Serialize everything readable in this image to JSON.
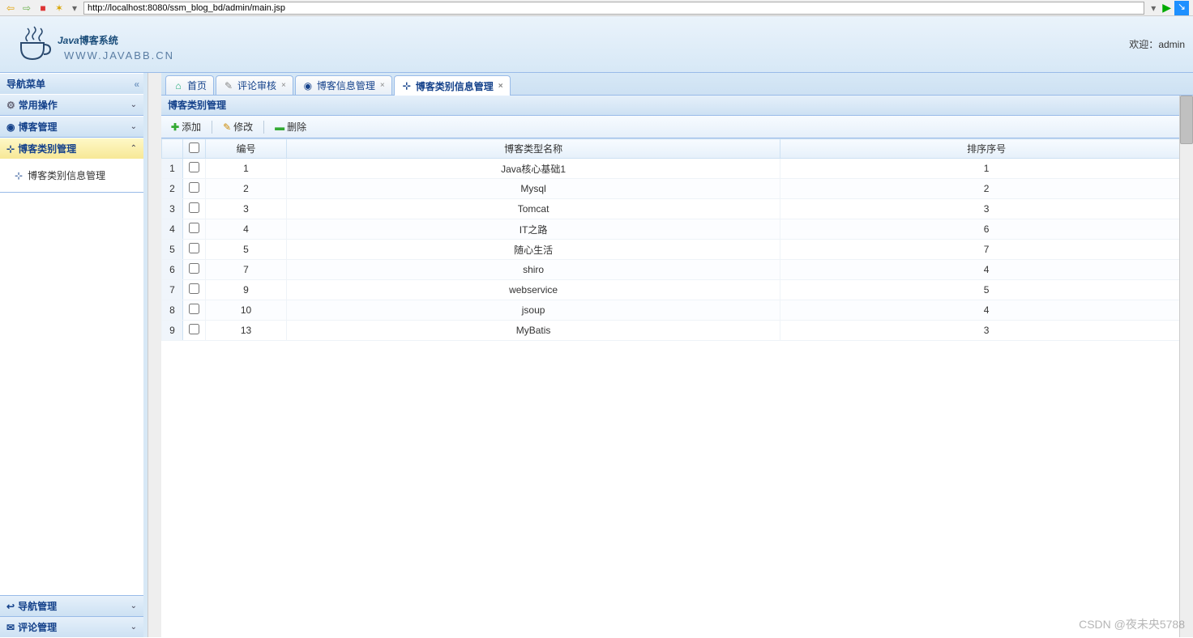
{
  "browser": {
    "url": "http://localhost:8080/ssm_blog_bd/admin/main.jsp"
  },
  "header": {
    "logo_main_en": "Java",
    "logo_main_cn": "博客系统",
    "logo_sub": "WWW.JAVABB.CN",
    "welcome_label": "欢迎：",
    "welcome_user": "admin"
  },
  "sidebar": {
    "title": "导航菜单",
    "sections": [
      {
        "icon": "gears",
        "label": "常用操作"
      },
      {
        "icon": "blog",
        "label": "博客管理"
      },
      {
        "icon": "tree",
        "label": "博客类别管理",
        "selected": true,
        "expanded": true,
        "children": [
          {
            "icon": "tree",
            "label": "博客类别信息管理"
          }
        ]
      }
    ],
    "footer": [
      {
        "icon": "back",
        "label": "导航管理"
      },
      {
        "icon": "comments",
        "label": "评论管理"
      }
    ]
  },
  "tabs": [
    {
      "icon": "home",
      "label": "首页",
      "closable": false
    },
    {
      "icon": "comment",
      "label": "评论审核",
      "closable": true
    },
    {
      "icon": "blog",
      "label": "博客信息管理",
      "closable": true
    },
    {
      "icon": "tree",
      "label": "博客类别信息管理",
      "closable": true,
      "active": true
    }
  ],
  "panel_title": "博客类别管理",
  "toolbar": {
    "add": "添加",
    "edit": "修改",
    "delete": "删除"
  },
  "table": {
    "columns": {
      "id": "编号",
      "name": "博客类型名称",
      "order": "排序序号"
    },
    "rows": [
      {
        "n": 1,
        "id": 1,
        "name": "Java核心基础1",
        "order": 1
      },
      {
        "n": 2,
        "id": 2,
        "name": "Mysql",
        "order": 2
      },
      {
        "n": 3,
        "id": 3,
        "name": "Tomcat",
        "order": 3
      },
      {
        "n": 4,
        "id": 4,
        "name": "IT之路",
        "order": 6
      },
      {
        "n": 5,
        "id": 5,
        "name": "随心生活",
        "order": 7
      },
      {
        "n": 6,
        "id": 7,
        "name": "shiro",
        "order": 4
      },
      {
        "n": 7,
        "id": 9,
        "name": "webservice",
        "order": 5
      },
      {
        "n": 8,
        "id": 10,
        "name": "jsoup",
        "order": 4
      },
      {
        "n": 9,
        "id": 13,
        "name": "MyBatis",
        "order": 3
      }
    ]
  },
  "watermark": "CSDN @夜未央5788"
}
